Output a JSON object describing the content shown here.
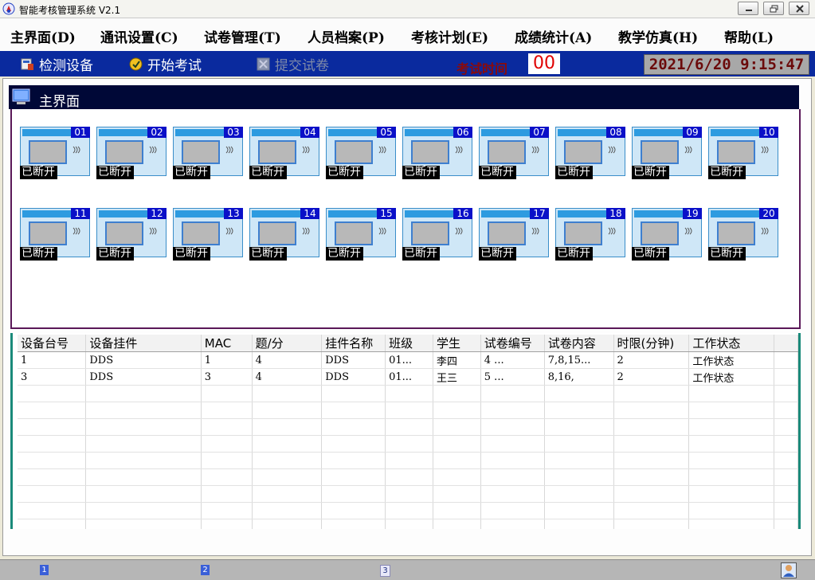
{
  "window": {
    "title": "智能考核管理系统 V2.1"
  },
  "menu": [
    {
      "label": "主界面(D)"
    },
    {
      "label": "通讯设置(C)"
    },
    {
      "label": "试卷管理(T)"
    },
    {
      "label": "人员档案(P)"
    },
    {
      "label": "考核计划(E)"
    },
    {
      "label": "成绩统计(A)"
    },
    {
      "label": "教学仿真(H)"
    },
    {
      "label": "帮助(L)"
    }
  ],
  "toolbar": {
    "detect_label": "检测设备",
    "start_label": "开始考试",
    "submit_label": "提交试卷",
    "exam_time_label": "考试时间",
    "exam_time_value": "00",
    "clock": "2021/6/20 9:15:47"
  },
  "panel": {
    "title": "主界面"
  },
  "devices": [
    {
      "num": "01",
      "status": "已断开"
    },
    {
      "num": "02",
      "status": "已断开"
    },
    {
      "num": "03",
      "status": "已断开"
    },
    {
      "num": "04",
      "status": "已断开"
    },
    {
      "num": "05",
      "status": "已断开"
    },
    {
      "num": "06",
      "status": "已断开"
    },
    {
      "num": "07",
      "status": "已断开"
    },
    {
      "num": "08",
      "status": "已断开"
    },
    {
      "num": "09",
      "status": "已断开"
    },
    {
      "num": "10",
      "status": "已断开"
    },
    {
      "num": "11",
      "status": "已断开"
    },
    {
      "num": "12",
      "status": "已断开"
    },
    {
      "num": "13",
      "status": "已断开"
    },
    {
      "num": "14",
      "status": "已断开"
    },
    {
      "num": "15",
      "status": "已断开"
    },
    {
      "num": "16",
      "status": "已断开"
    },
    {
      "num": "17",
      "status": "已断开"
    },
    {
      "num": "18",
      "status": "已断开"
    },
    {
      "num": "19",
      "status": "已断开"
    },
    {
      "num": "20",
      "status": "已断开"
    }
  ],
  "table": {
    "columns": [
      "设备台号",
      "设备挂件",
      "MAC",
      "题/分",
      "挂件名称",
      "班级",
      "学生",
      "试卷编号",
      "试卷内容",
      "时限(分钟)",
      "工作状态",
      ""
    ],
    "rows": [
      [
        "1",
        "DDS",
        "1",
        "4",
        "DDS",
        "01...",
        "李四",
        "4 ...",
        "7,8,15...",
        "2",
        "工作状态",
        ""
      ],
      [
        "3",
        "DDS",
        "3",
        "4",
        "DDS",
        "01...",
        "王三",
        "5 ...",
        "8,16,",
        "2",
        "工作状态",
        ""
      ]
    ],
    "empty_rows": 9
  },
  "statusbar": {
    "panels": [
      "1",
      "2",
      "3"
    ]
  },
  "colors": {
    "toolbar_bg": "#0a2a9e",
    "panel_header_bg": "#000837",
    "device_number_bg": "#0a10c8",
    "table_border": "#1a8a7a",
    "exam_time_text": "#e00000"
  }
}
